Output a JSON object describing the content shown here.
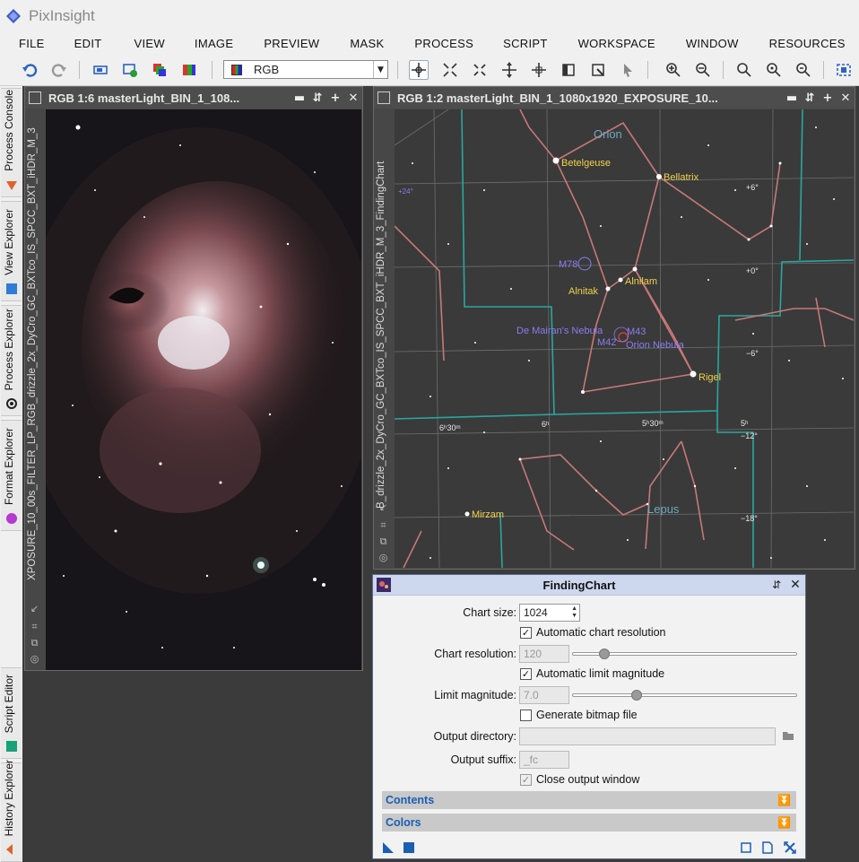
{
  "app": {
    "title": "PixInsight"
  },
  "menu": [
    "FILE",
    "EDIT",
    "VIEW",
    "IMAGE",
    "PREVIEW",
    "MASK",
    "PROCESS",
    "SCRIPT",
    "WORKSPACE",
    "WINDOW",
    "RESOURCES"
  ],
  "toolbar": {
    "channel_select": "RGB"
  },
  "left_dock": {
    "tabs": [
      "Process Console",
      "View Explorer",
      "Process Explorer",
      "Format Explorer",
      "Script Editor",
      "History Explorer"
    ]
  },
  "window1": {
    "title": "RGB 1:6 masterLight_BIN_1_108...",
    "side_label": "XPOSURE_10_00s_FILTER_LP_RGB_drizzle_2x_DyCro_GC_BXTco_IS_SPCC_BXT_iHDR_M_3"
  },
  "window2": {
    "title": "RGB 1:2 masterLight_BIN_1_1080x1920_EXPOSURE_10...",
    "side_label": "B_drizzle_2x_DyCro_GC_BXTco_IS_SPCC_BXT_iHDR_M_3_FindingChart",
    "chart_labels": {
      "constellation_orion": "Orion",
      "constellation_lepus": "Lepus",
      "betelgeuse": "Betelgeuse",
      "bellatrix": "Bellatrix",
      "m78": "M78",
      "alnitak": "Alnitak",
      "alnilam": "Alnilam",
      "de_mairan": "De Mairan's Nebula",
      "m43": "M43",
      "m42": "M42",
      "orion_nebula": "Orion Nebula",
      "rigel": "Rigel",
      "mirzam": "Mirzam",
      "dec_p6": "+6°",
      "dec_0": "+0°",
      "dec_m6": "−6°",
      "dec_m12": "−12°",
      "dec_m18": "−18°",
      "ra_630": "6ʰ30ᵐ",
      "ra_6": "6ʰ",
      "ra_530": "5ʰ30ᵐ",
      "ra_5": "5ʰ",
      "dec_24": "+24°"
    }
  },
  "dialog": {
    "title": "FindingChart",
    "chart_size_label": "Chart size:",
    "chart_size_value": "1024",
    "auto_resolution_label": "Automatic chart resolution",
    "chart_resolution_label": "Chart resolution:",
    "chart_resolution_value": "120",
    "chart_resolution_fraction": 0.12,
    "auto_limit_label": "Automatic limit magnitude",
    "limit_magnitude_label": "Limit magnitude:",
    "limit_magnitude_value": "7.0",
    "limit_magnitude_fraction": 0.27,
    "generate_bitmap_label": "Generate bitmap file",
    "output_directory_label": "Output directory:",
    "output_directory_value": "",
    "output_suffix_label": "Output suffix:",
    "output_suffix_value": "_fc",
    "close_output_label": "Close output window",
    "section_contents": "Contents",
    "section_colors": "Colors"
  },
  "colors": {
    "chart_line": "#c87878",
    "chart_border": "#2aa7a0",
    "chart_label": "#f0d24a",
    "chart_dso": "#8a7cf0",
    "accent": "#1a5fb4"
  }
}
